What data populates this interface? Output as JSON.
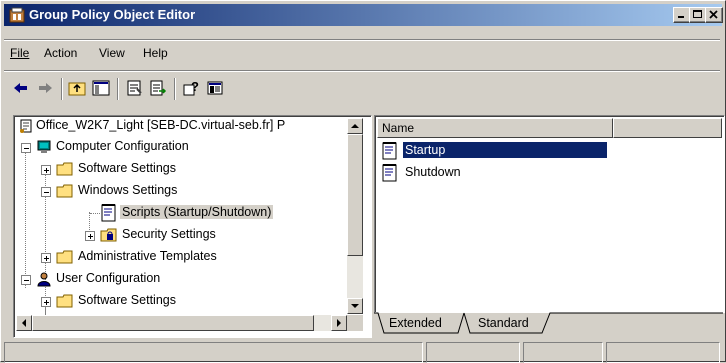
{
  "window": {
    "title": "Group Policy Object Editor"
  },
  "menu": {
    "items": [
      {
        "label": "File"
      },
      {
        "label": "Action"
      },
      {
        "label": "View"
      },
      {
        "label": "Help"
      }
    ]
  },
  "toolbar": {
    "icons": [
      "back-arrow-icon",
      "forward-arrow-icon",
      "up-folder-icon",
      "show-hide-tree-icon",
      "properties-icon",
      "export-list-icon",
      "help-icon",
      "show-hide-console-icon"
    ]
  },
  "tree": {
    "items": [
      {
        "label": "Office_W2K7_Light [SEB-DC.virtual-seb.fr] P"
      },
      {
        "label": "Computer Configuration"
      },
      {
        "label": "Software Settings"
      },
      {
        "label": "Windows Settings"
      },
      {
        "label": "Scripts (Startup/Shutdown)"
      },
      {
        "label": "Security Settings"
      },
      {
        "label": "Administrative Templates"
      },
      {
        "label": "User Configuration"
      },
      {
        "label": "Software Settings"
      }
    ]
  },
  "list": {
    "column": "Name",
    "items": [
      {
        "label": "Startup",
        "selected": true
      },
      {
        "label": "Shutdown",
        "selected": false
      }
    ]
  },
  "tabs": [
    {
      "label": "Extended"
    },
    {
      "label": "Standard",
      "active": true
    }
  ]
}
